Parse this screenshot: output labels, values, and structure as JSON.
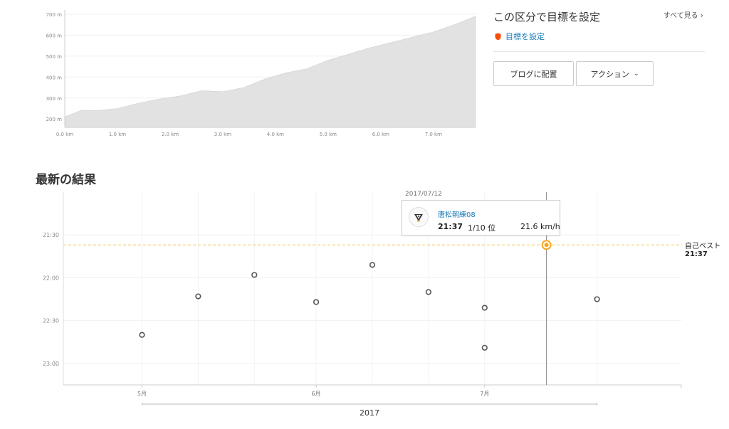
{
  "elevation_chart": {
    "chart_data": {
      "type": "area",
      "title": "",
      "xlabel": "",
      "ylabel": "",
      "x_unit": "km",
      "y_unit": "m",
      "xlim": [
        0,
        7.8
      ],
      "ylim": [
        160,
        720
      ],
      "x_ticks": [
        "0.0 km",
        "1.0 km",
        "2.0 km",
        "3.0 km",
        "4.0 km",
        "5.0 km",
        "6.0 km",
        "7.0 km"
      ],
      "y_ticks": [
        "200 m",
        "300 m",
        "400 m",
        "500 m",
        "600 m",
        "700 m"
      ],
      "x": [
        0,
        0.3,
        0.6,
        1.0,
        1.4,
        1.8,
        2.2,
        2.6,
        3.0,
        3.4,
        3.8,
        4.2,
        4.6,
        5.0,
        5.4,
        5.8,
        6.2,
        6.6,
        7.0,
        7.4,
        7.8
      ],
      "y": [
        210,
        240,
        240,
        250,
        275,
        295,
        310,
        335,
        330,
        350,
        390,
        420,
        440,
        480,
        510,
        540,
        565,
        590,
        615,
        650,
        690
      ],
      "fill_color": "#e2e2e2",
      "grid": true
    }
  },
  "goal_panel": {
    "title": "この区分で目標を設定",
    "see_all": "すべて見る",
    "set_goal": "目標を設定",
    "set_goal_icon": "shield-icon",
    "accent_color": "#fc4c02"
  },
  "buttons": {
    "blog": "ブログに配置",
    "action": "アクション",
    "action_icon": "chevron-down-icon"
  },
  "latest_results": {
    "heading": "最新の結果",
    "chart_data": {
      "type": "scatter",
      "title": "",
      "xlabel": "",
      "ylabel": "",
      "x_axis": "date",
      "y_axis": "elapsed time (mm:ss), reversed",
      "year_label": "2017",
      "x_tick_labels": [
        "5月",
        "6月",
        "7月"
      ],
      "y_tick_labels": [
        "21:30",
        "22:00",
        "22:30",
        "23:00"
      ],
      "ylim": [
        "23:15",
        "21:00"
      ],
      "points": [
        {
          "date": "2017-05-01",
          "time": "22:40"
        },
        {
          "date": "2017-05-11",
          "time": "22:13"
        },
        {
          "date": "2017-05-21",
          "time": "21:58"
        },
        {
          "date": "2017-06-01",
          "time": "22:17"
        },
        {
          "date": "2017-06-11",
          "time": "21:51"
        },
        {
          "date": "2017-06-21",
          "time": "22:10"
        },
        {
          "date": "2017-07-01",
          "time": "22:49"
        },
        {
          "date": "2017-07-01",
          "time": "22:21"
        },
        {
          "date": "2017-07-12",
          "time": "21:37",
          "highlight": true
        },
        {
          "date": "2017-07-21",
          "time": "22:15"
        }
      ],
      "personal_record": {
        "label": "自己ベスト",
        "time": "21:37"
      },
      "point_color": "#555555",
      "highlight_color": "#f5a623",
      "pr_line_color": "#f0c24b"
    },
    "tooltip": {
      "date": "2017/07/12",
      "athlete": "唐松朝練08",
      "time": "21:37",
      "rank": "1/10 位",
      "speed": "21.6 km/h",
      "avatar_icon": "club-logo-icon"
    }
  }
}
